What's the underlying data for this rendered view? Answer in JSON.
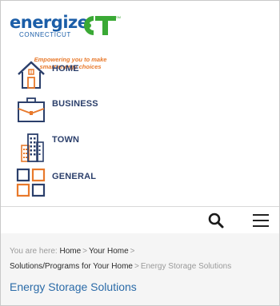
{
  "logo": {
    "word": "energize",
    "sub": "CONNECTICUT",
    "ct": "CT",
    "tagline": "Empowering you to make smart energy choices"
  },
  "menu": [
    {
      "label": "HOME",
      "icon": "house-icon"
    },
    {
      "label": "BUSINESS",
      "icon": "briefcase-icon"
    },
    {
      "label": "TOWN",
      "icon": "buildings-icon"
    },
    {
      "label": "GENERAL",
      "icon": "grid-icon"
    }
  ],
  "toolbar": {
    "search_icon": "search-icon",
    "menu_icon": "hamburger-menu-icon"
  },
  "breadcrumb": {
    "prefix": "You are here:",
    "links": [
      "Home",
      "Your Home",
      "Solutions/Programs for Your Home"
    ],
    "separator": ">",
    "current": "Energy Storage Solutions"
  },
  "page": {
    "title": "Energy Storage Solutions"
  },
  "colors": {
    "brand_blue": "#1b5ea8",
    "brand_green": "#3aa935",
    "brand_orange": "#e8792b",
    "nav_navy": "#2b3f6b",
    "title_blue": "#2b6ba8"
  }
}
